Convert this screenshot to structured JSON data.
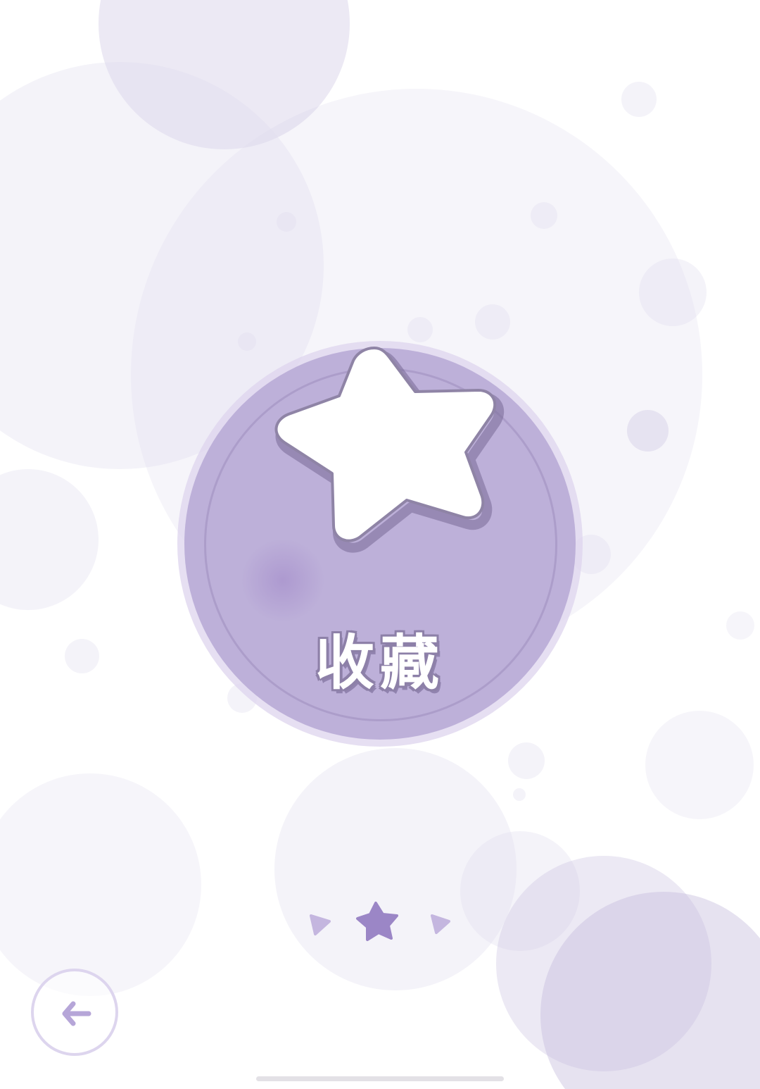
{
  "app": {
    "accent_color": "#bdb0d9",
    "star_color": "#9b86c6",
    "background_color": "#ffffff"
  },
  "favorite": {
    "label": "收藏",
    "icon": "star-icon"
  },
  "pager": {
    "current_icon": "star-icon",
    "prev_icon": "triangle-left-icon",
    "next_icon": "triangle-right-icon"
  },
  "back_button": {
    "icon": "arrow-left-icon"
  }
}
